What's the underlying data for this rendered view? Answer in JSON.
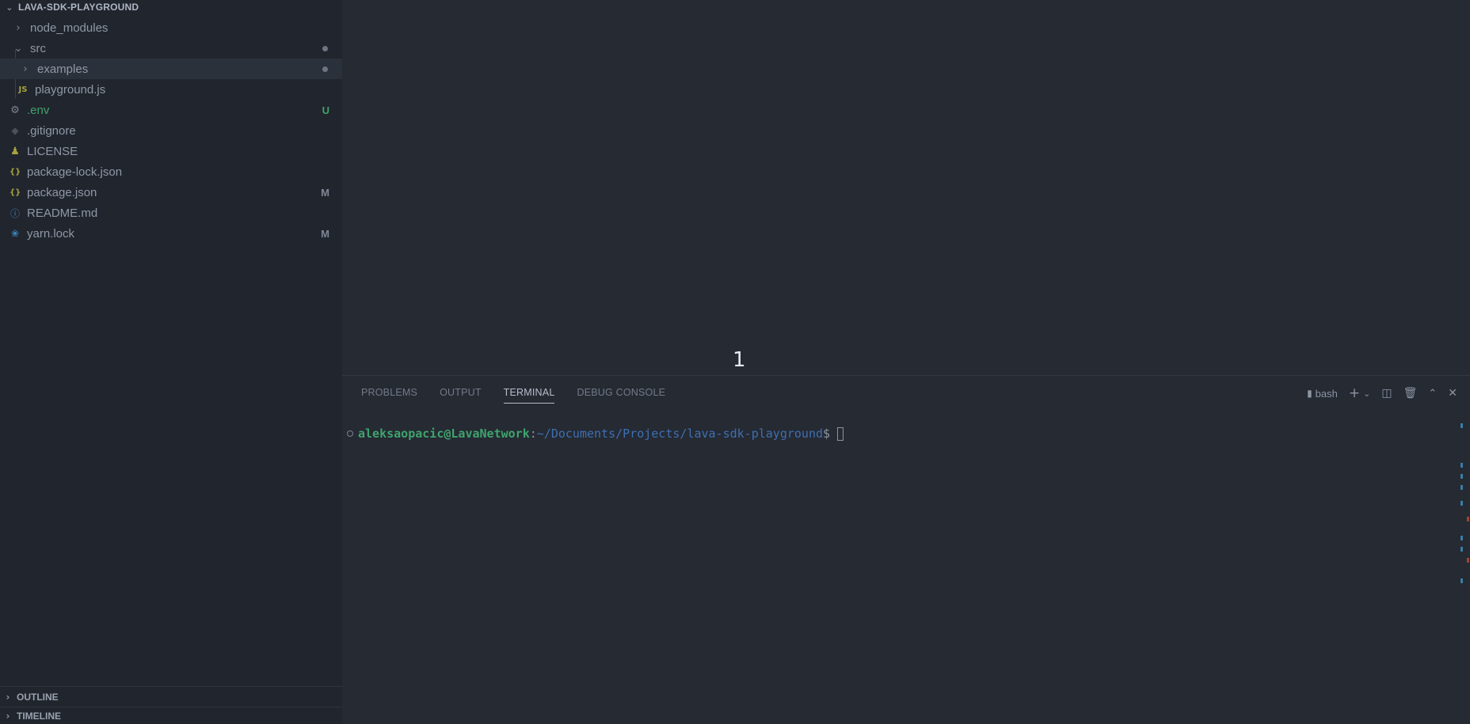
{
  "explorer": {
    "title": "LAVA-SDK-PLAYGROUND",
    "items": [
      {
        "label": "node_modules",
        "kind": "folder",
        "expanded": false,
        "icon": "chevron-right-icon"
      },
      {
        "label": "src",
        "kind": "folder",
        "expanded": true,
        "icon": "chevron-down-icon"
      },
      {
        "label": "examples",
        "kind": "folder",
        "expanded": false,
        "icon": "chevron-right-icon"
      },
      {
        "label": "playground.js",
        "kind": "file",
        "icon_text": "JS"
      },
      {
        "label": ".env",
        "kind": "file",
        "icon": "gear-icon",
        "badge": "U"
      },
      {
        "label": ".gitignore",
        "kind": "file",
        "icon": "git-diamond-icon"
      },
      {
        "label": "LICENSE",
        "kind": "file",
        "icon": "license-person-icon"
      },
      {
        "label": "package-lock.json",
        "kind": "file",
        "icon_text": "{}"
      },
      {
        "label": "package.json",
        "kind": "file",
        "icon_text": "{}",
        "badge": "M"
      },
      {
        "label": "README.md",
        "kind": "file",
        "icon": "info-icon"
      },
      {
        "label": "yarn.lock",
        "kind": "file",
        "icon": "yarn-icon",
        "badge": "M"
      }
    ]
  },
  "sections": {
    "outline": "OUTLINE",
    "timeline": "TIMELINE"
  },
  "editor": {
    "overlay_number": "1"
  },
  "panel": {
    "tabs": [
      "PROBLEMS",
      "OUTPUT",
      "TERMINAL",
      "DEBUG CONSOLE"
    ],
    "active_tab": "TERMINAL",
    "shell": "bash"
  },
  "terminal": {
    "user_host": "aleksaopacic@LavaNetwork",
    "colon": ":",
    "path": "~/Documents/Projects/lava-sdk-playground",
    "prompt": "$"
  },
  "colors": {
    "untracked": "#3fa36c",
    "modified": "#a08a3a",
    "folder_icon": "#8b93a0",
    "js_icon": "#a7a33d",
    "json_icon": "#a7a33d",
    "info_icon": "#4a89c9",
    "yarn_icon": "#3b82b8"
  }
}
